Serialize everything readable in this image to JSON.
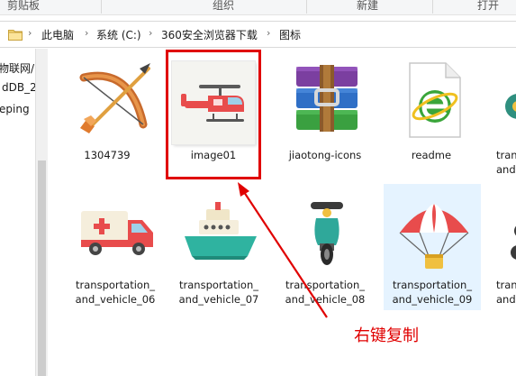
{
  "ribbon": {
    "groups": [
      "剪贴板",
      "组织",
      "新建",
      "打开"
    ]
  },
  "address": {
    "segments": [
      "此电脑",
      "系统 (C:)",
      "360安全浏览器下载",
      "图标"
    ]
  },
  "nav": {
    "items": [
      "物联网/",
      "dDB_2",
      "eping"
    ]
  },
  "files": [
    {
      "name": "1304739",
      "icon": "bow-arrow-icon"
    },
    {
      "name": "image01",
      "icon": "helicopter-icon"
    },
    {
      "name": "jiaotong-icons",
      "icon": "winrar-archive-icon"
    },
    {
      "name": "readme",
      "icon": "ie-document-icon"
    },
    {
      "name": "tran",
      "name2": "and",
      "icon": "partial-transport-icon"
    },
    {
      "name": "transportation_",
      "name2": "and_vehicle_06",
      "icon": "ambulance-icon"
    },
    {
      "name": "transportation_",
      "name2": "and_vehicle_07",
      "icon": "ship-icon"
    },
    {
      "name": "transportation_",
      "name2": "and_vehicle_08",
      "icon": "scooter-icon"
    },
    {
      "name": "transportation_",
      "name2": "and_vehicle_09",
      "icon": "parachute-icon"
    },
    {
      "name": "tran",
      "name2": "and",
      "icon": "partial-transport-icon"
    }
  ],
  "annotation": {
    "text": "右键复制",
    "color": "#e00000"
  }
}
